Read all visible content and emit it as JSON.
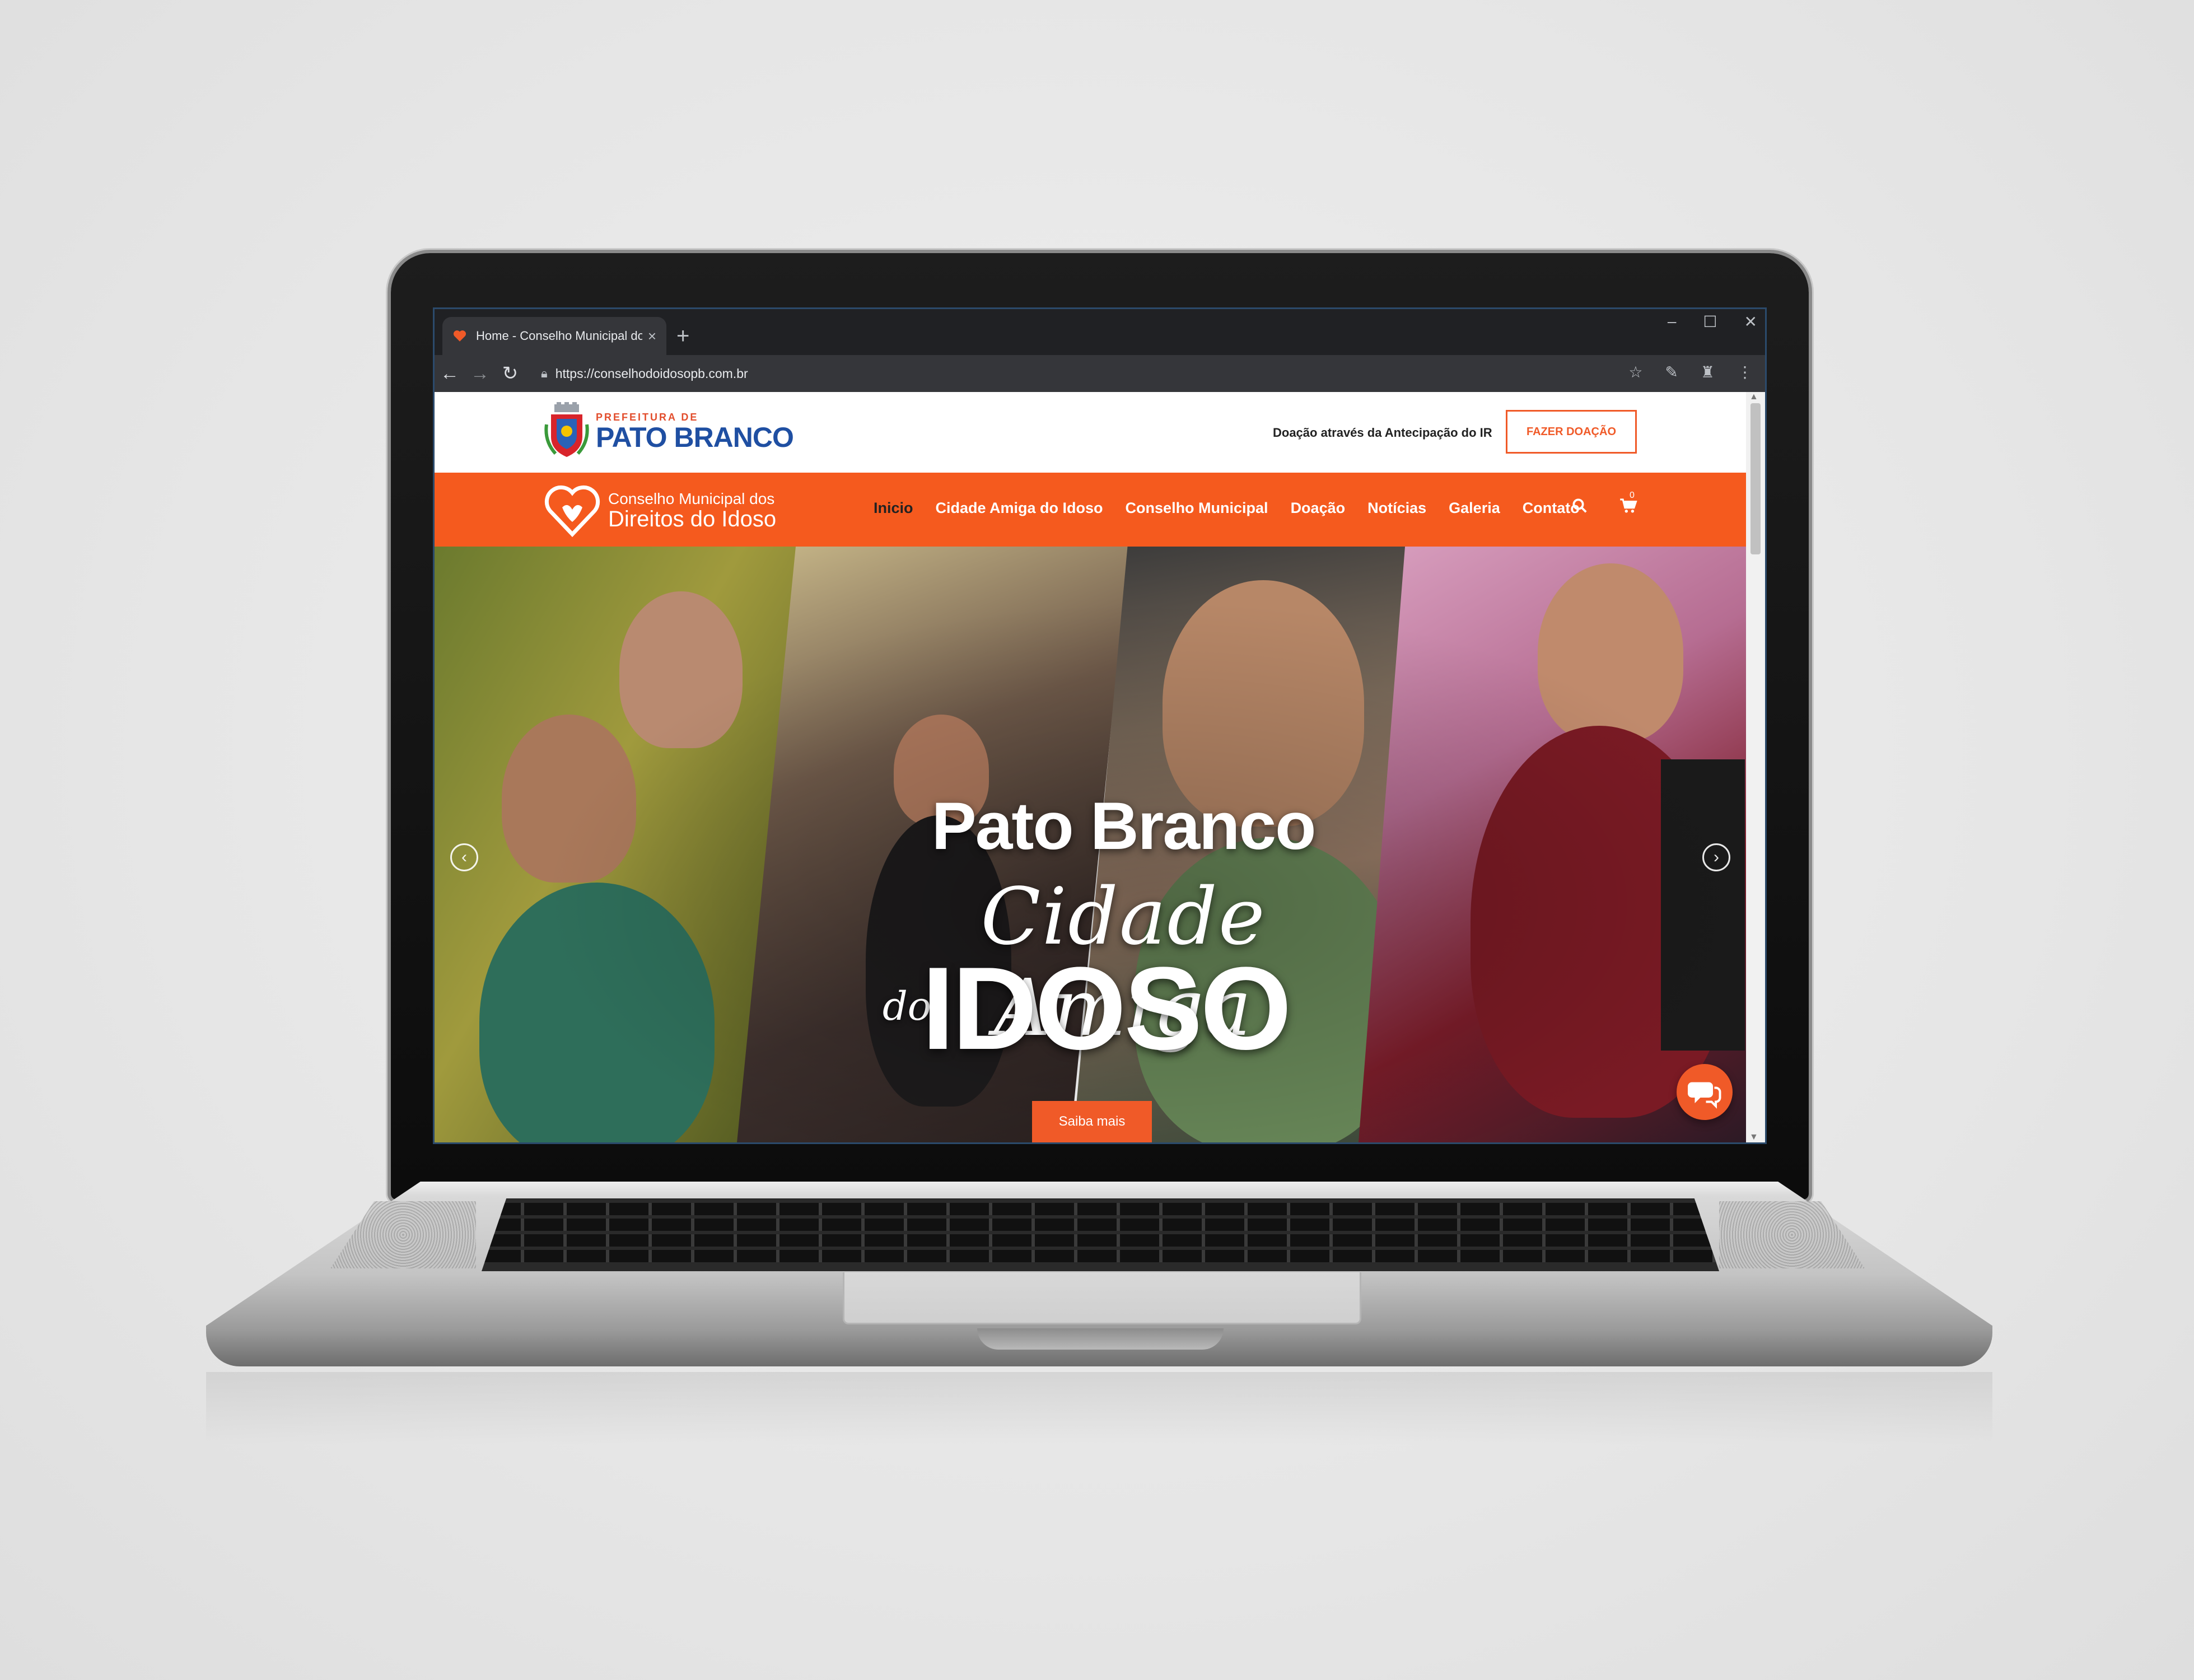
{
  "browser": {
    "tab_title": "Home - Conselho Municipal dos",
    "tab_close": "×",
    "new_tab": "+",
    "url": "https://conselhodoidosopb.com.br",
    "window_controls": [
      "–",
      "☐",
      "✕"
    ]
  },
  "site": {
    "prefeitura_small": "PREFEITURA DE",
    "prefeitura_big": "PATO BRANCO",
    "donation_text": "Doação através da Antecipação do IR",
    "donation_button": "FAZER DOAÇÃO",
    "council_line1": "Conselho Municipal dos",
    "council_line2": "Direitos do Idoso",
    "menu": [
      "Inicio",
      "Cidade Amiga do Idoso",
      "Conselho Municipal",
      "Doação",
      "Notícias",
      "Galeria",
      "Contato"
    ],
    "cart_count": "0"
  },
  "hero": {
    "title": "Pato Branco",
    "script": "Cidade Amiga",
    "small": "do",
    "big": "IDOSO",
    "cta": "Saiba mais"
  },
  "colors": {
    "brand_orange": "#f55a1e",
    "brand_blue": "#1f4fa2"
  },
  "icons": [
    "back-icon",
    "forward-icon",
    "reload-icon",
    "lock-icon",
    "star-icon",
    "extension-icon",
    "menu-dots-icon",
    "search-icon",
    "cart-icon",
    "chat-icon",
    "arrow-left-icon",
    "arrow-right-icon"
  ]
}
